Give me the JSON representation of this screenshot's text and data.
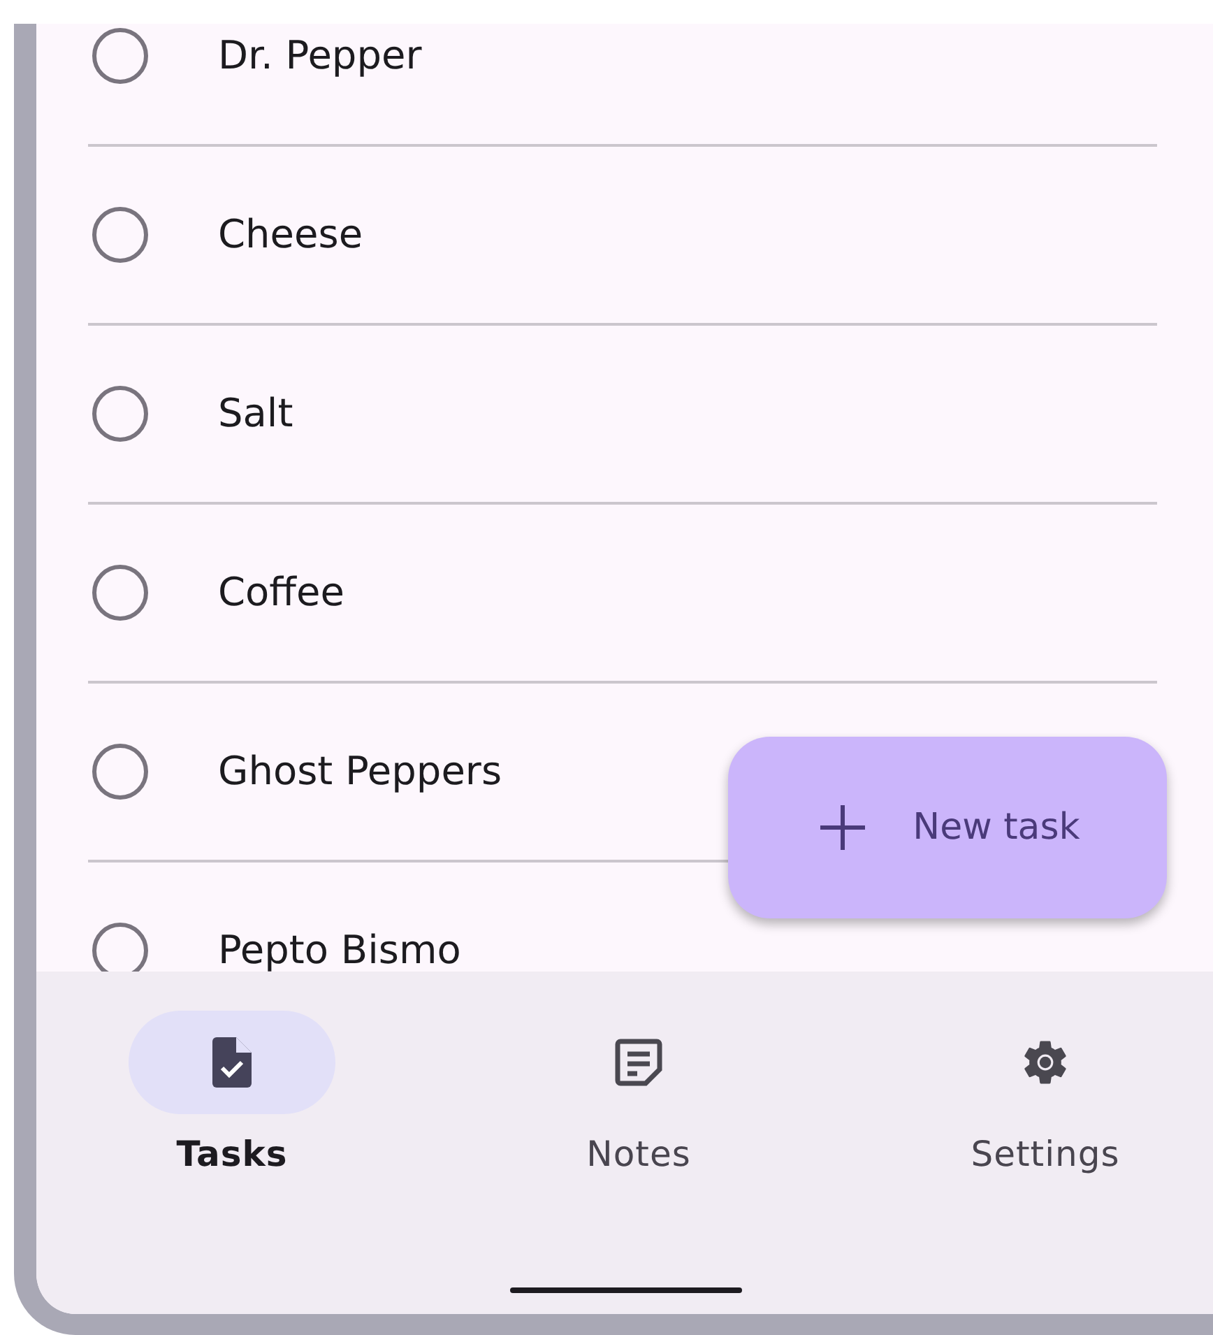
{
  "tasks": [
    {
      "label": "Dr. Pepper",
      "checked": false
    },
    {
      "label": "Cheese",
      "checked": false
    },
    {
      "label": "Salt",
      "checked": false
    },
    {
      "label": "Coffee",
      "checked": false
    },
    {
      "label": "Ghost Peppers",
      "checked": false
    },
    {
      "label": "Pepto Bismo",
      "checked": false
    }
  ],
  "fab": {
    "label": "New task"
  },
  "nav": [
    {
      "label": "Tasks",
      "selected": true
    },
    {
      "label": "Notes",
      "selected": false
    },
    {
      "label": "Settings",
      "selected": false
    }
  ]
}
